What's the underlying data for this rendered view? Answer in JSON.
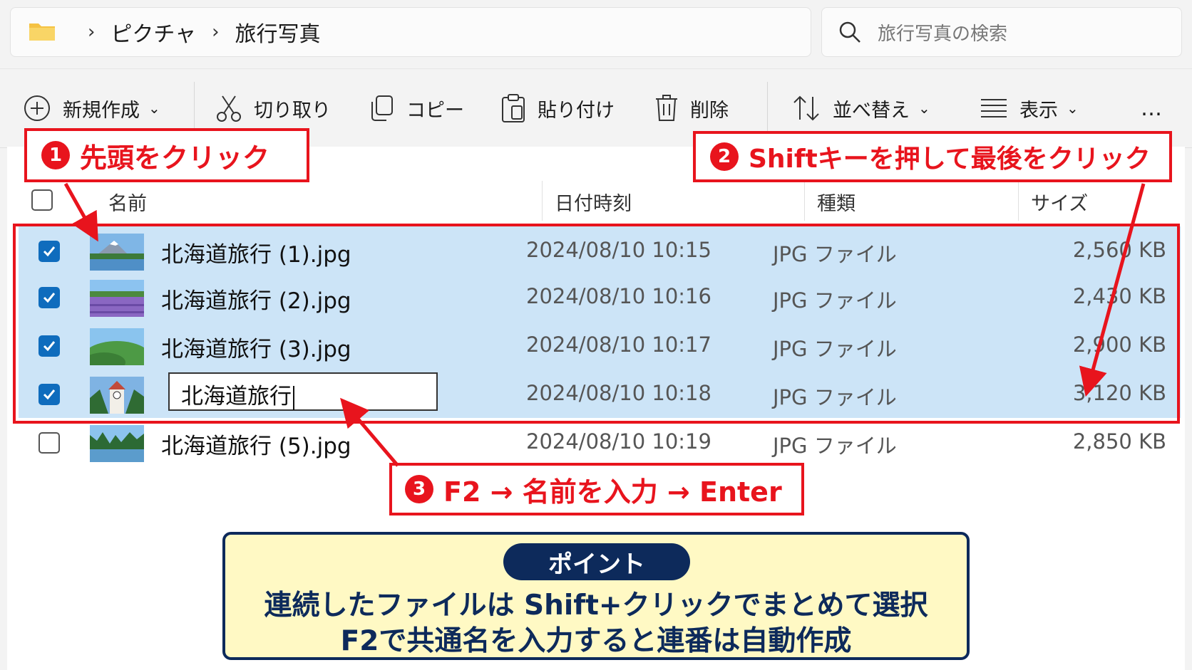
{
  "breadcrumb": {
    "items": [
      "ピクチャ",
      "旅行写真"
    ]
  },
  "search": {
    "placeholder": "旅行写真の検索"
  },
  "toolbar": {
    "new": "新規作成",
    "cut": "切り取り",
    "copy": "コピー",
    "paste": "貼り付け",
    "delete": "削除",
    "sort": "並べ替え",
    "view": "表示",
    "more": "…"
  },
  "columns": {
    "name": "名前",
    "date": "日付時刻",
    "type": "種類",
    "size": "サイズ"
  },
  "files": [
    {
      "name": "北海道旅行 (1).jpg",
      "date": "2024/08/10  10:15",
      "type": "JPG ファイル",
      "size": "2,560 KB",
      "selected": true,
      "thumb": "mountain-lake"
    },
    {
      "name": "北海道旅行 (2).jpg",
      "date": "2024/08/10  10:16",
      "type": "JPG ファイル",
      "size": "2,430 KB",
      "selected": true,
      "thumb": "lavender-field"
    },
    {
      "name": "北海道旅行 (3).jpg",
      "date": "2024/08/10  10:17",
      "type": "JPG ファイル",
      "size": "2,900 KB",
      "selected": true,
      "thumb": "green-hills"
    },
    {
      "name": "北海道旅行",
      "date": "2024/08/10  10:18",
      "type": "JPG ファイル",
      "size": "3,120 KB",
      "selected": true,
      "thumb": "clock-tower",
      "editing": true
    },
    {
      "name": "北海道旅行 (5).jpg",
      "date": "2024/08/10  10:19",
      "type": "JPG ファイル",
      "size": "2,850 KB",
      "selected": false,
      "thumb": "forest-lake"
    }
  ],
  "callouts": {
    "c1": {
      "num": "1",
      "text": "先頭をクリック"
    },
    "c2": {
      "num": "2",
      "text": "Shiftキーを押して最後をクリック"
    },
    "c3": {
      "num": "3",
      "text": "F2 → 名前を入力 → Enter"
    }
  },
  "point": {
    "badge": "ポイント",
    "line1": "連続したファイルは Shift+クリックでまとめて選択",
    "line2": "F2で共通名を入力すると連番は自動作成"
  },
  "colors": {
    "accent": "#e8141d",
    "selection": "#cce4f7",
    "navy": "#0d2a5b",
    "checkbox": "#0f6cbd"
  }
}
